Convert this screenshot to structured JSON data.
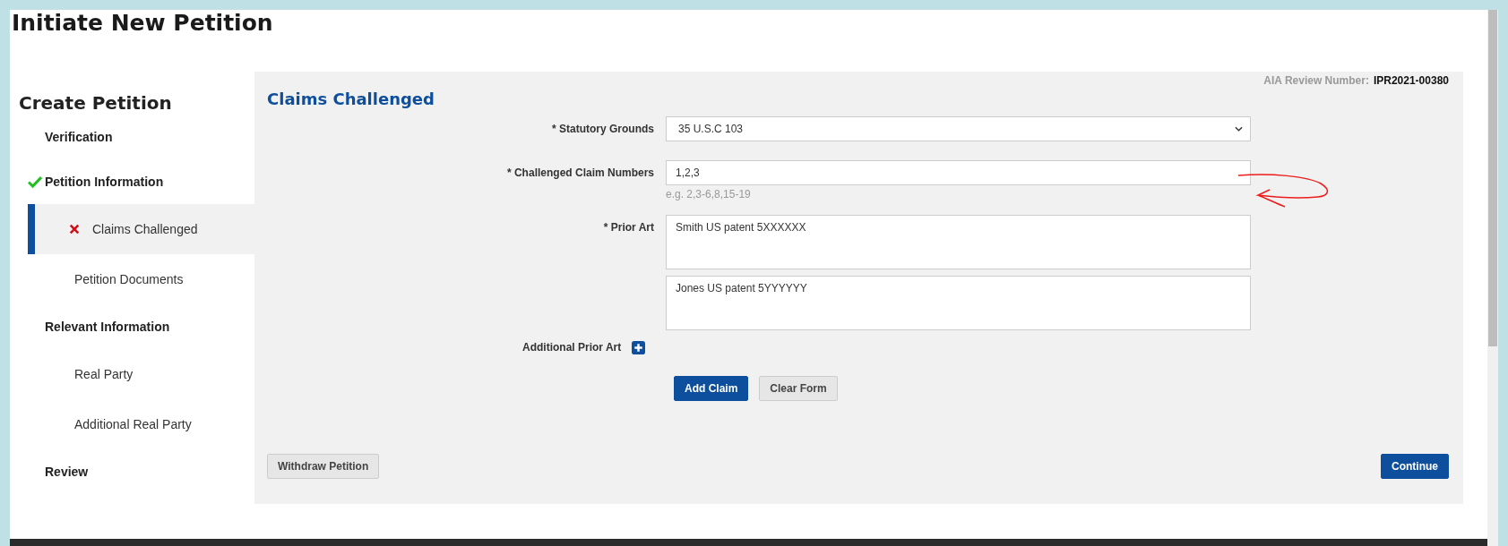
{
  "page": {
    "title": "Initiate New Petition"
  },
  "sidebar": {
    "title": "Create Petition",
    "items": [
      {
        "label": "Verification",
        "complete": false,
        "failed": false,
        "selected": false
      },
      {
        "label": "Petition Information",
        "complete": true,
        "failed": false,
        "selected": false,
        "children": [
          {
            "label": "Claims Challenged",
            "complete": false,
            "failed": true,
            "selected": true
          },
          {
            "label": "Petition Documents",
            "complete": false,
            "failed": false,
            "selected": false
          }
        ]
      },
      {
        "label": "Relevant Information",
        "complete": false,
        "failed": false,
        "selected": false,
        "children": [
          {
            "label": "Real Party",
            "complete": false,
            "failed": false,
            "selected": false
          },
          {
            "label": "Additional Real Party",
            "complete": false,
            "failed": false,
            "selected": false
          }
        ]
      },
      {
        "label": "Review",
        "complete": false,
        "failed": false,
        "selected": false
      }
    ]
  },
  "form": {
    "heading": "Claims Challenged",
    "review_number": {
      "label": "AIA Review Number:",
      "value": "IPR2021-00380"
    },
    "fields": [
      {
        "kind": "select",
        "label": "* Statutory Grounds",
        "value": "35 U.S.C 103"
      },
      {
        "kind": "input",
        "label": "* Challenged Claim Numbers",
        "value": "1,2,3",
        "hint": "e.g. 2,3-6,8,15-19"
      },
      {
        "kind": "textareas",
        "label": "* Prior Art",
        "values": [
          "Smith US patent 5XXXXXX",
          "Jones US patent 5YYYYYY"
        ]
      }
    ],
    "additional": {
      "label": "Additional Prior Art"
    },
    "buttons": [
      {
        "kind": "primary",
        "label": "Add Claim"
      },
      {
        "kind": "secondary",
        "label": "Clear Form"
      }
    ],
    "withdraw": "Withdraw Petition",
    "continue": "Continue"
  }
}
